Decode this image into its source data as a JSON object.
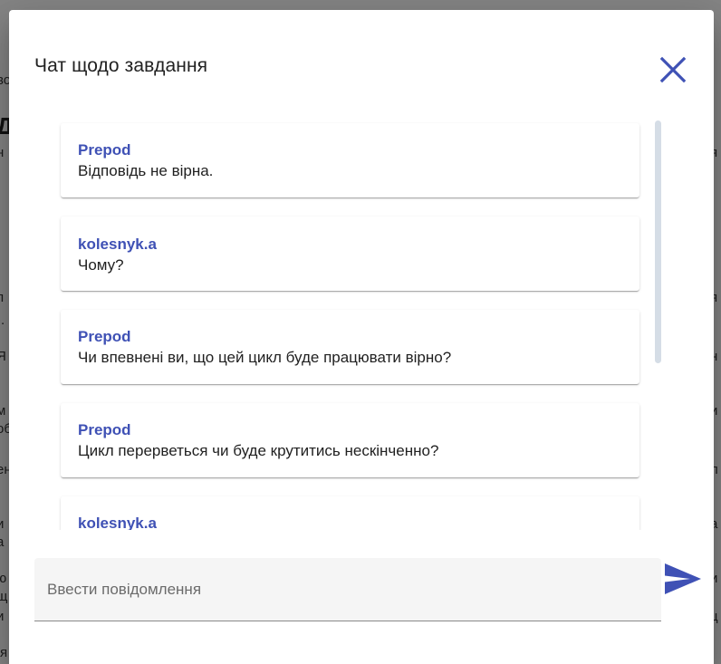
{
  "dialog": {
    "title": "Чат щодо завдання",
    "close_icon": "close-icon",
    "accent_color": "#3f51b5"
  },
  "messages": [
    {
      "author": "Prepod",
      "text": "Відповідь не вірна."
    },
    {
      "author": "kolesnyk.a",
      "text": "Чому?"
    },
    {
      "author": "Prepod",
      "text": "Чи впевнені ви, що цей цикл буде працювати вірно?"
    },
    {
      "author": "Prepod",
      "text": "Цикл перерветься чи буде крутитись нескінченно?"
    },
    {
      "author": "kolesnyk.a",
      "text": ""
    }
  ],
  "composer": {
    "placeholder": "Ввести повідомлення",
    "value": "",
    "send_icon": "send-icon"
  }
}
